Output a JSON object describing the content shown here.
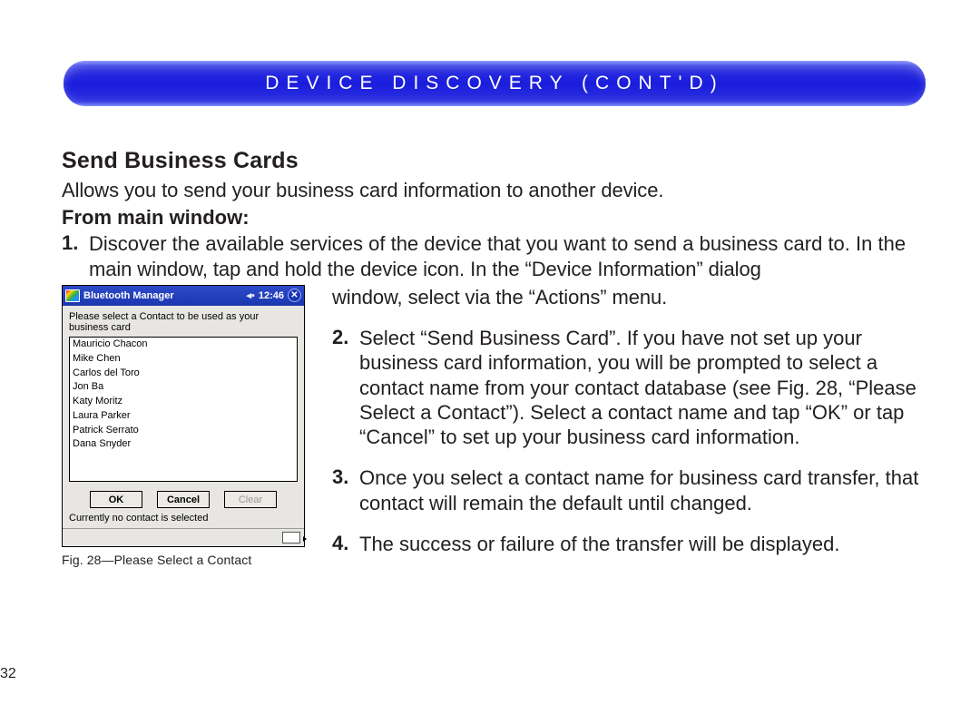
{
  "header": {
    "title": "DEVICE DISCOVERY (CONT'D)"
  },
  "section": {
    "heading": "Send Business Cards",
    "intro": "Allows you to send your business card information to another device.",
    "subheading": "From main window:",
    "step1_num": "1.",
    "step1_line1": "Discover the available services of the device that you want to send a business card to. In the",
    "step1_line2": "main window, tap and hold the device icon. In the “Device Information” dialog",
    "step1_line3": "window, select via the “Actions” menu.",
    "step2_num": "2.",
    "step2_text": "Select “Send Business Card”. If you have not set up your business card information, you will be prompted to select a contact name from your contact database (see Fig. 28, “Please Select a Contact”). Select a contact name and tap “OK” or tap “Cancel” to set up your business card information.",
    "step3_num": "3.",
    "step3_text": "Once you select a contact name for business card transfer, that contact will remain the default until changed.",
    "step4_num": "4.",
    "step4_text": "The success or failure of the transfer will be displayed."
  },
  "figure": {
    "caption": "Fig. 28—Please Select a Contact",
    "pda": {
      "startIcon": "windows-start-icon",
      "title": "Bluetooth Manager",
      "soundIcon": "◂▪",
      "clock": "12:46",
      "closeGlyph": "✕",
      "prompt": "Please select a Contact to be used as your business card",
      "contacts": [
        "Mauricio Chacon",
        "Mike Chen",
        "Carlos del Toro",
        "Jon Ba",
        "Katy Moritz",
        "Laura Parker",
        "Patrick Serrato",
        "Dana Snyder"
      ],
      "okLabel": "OK",
      "cancelLabel": "Cancel",
      "clearLabel": "Clear",
      "status": "Currently no contact is selected",
      "kbdIcon": "keyboard-icon"
    }
  },
  "pageNumber": "32"
}
